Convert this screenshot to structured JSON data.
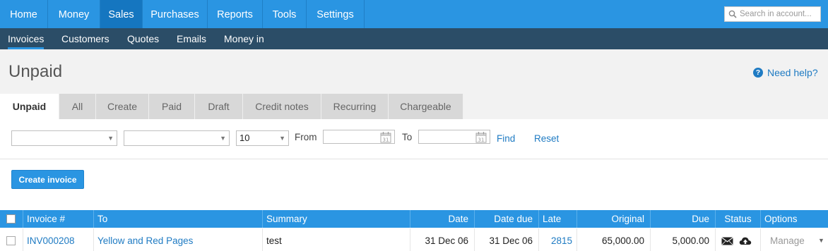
{
  "topnav": {
    "items": [
      "Home",
      "Money",
      "Sales",
      "Purchases",
      "Reports",
      "Tools",
      "Settings"
    ],
    "active": "Sales"
  },
  "search": {
    "placeholder": "Search in account..."
  },
  "subnav": {
    "items": [
      "Invoices",
      "Customers",
      "Quotes",
      "Emails",
      "Money in"
    ],
    "active": "Invoices"
  },
  "page": {
    "title": "Unpaid",
    "help": "Need help?"
  },
  "tabs": [
    "Unpaid",
    "All",
    "Create",
    "Paid",
    "Draft",
    "Credit notes",
    "Recurring",
    "Chargeable"
  ],
  "filters": {
    "select1": "",
    "select2": "",
    "per_page": "10",
    "from_label": "From",
    "to_label": "To",
    "find": "Find",
    "reset": "Reset"
  },
  "actions": {
    "create_invoice": "Create invoice"
  },
  "table": {
    "headers": [
      "Invoice #",
      "To",
      "Summary",
      "Date",
      "Date due",
      "Late",
      "Original",
      "Due",
      "Status",
      "Options"
    ],
    "rows": [
      {
        "invoice": "INV000208",
        "to": "Yellow and Red Pages",
        "summary": "test",
        "date": "31 Dec 06",
        "date_due": "31 Dec 06",
        "late": "2815",
        "original": "65,000.00",
        "due": "5,000.00",
        "status_icons": [
          "envelope-icon",
          "cloud-upload-icon"
        ],
        "manage": "Manage"
      }
    ]
  },
  "colors": {
    "accent": "#2a95e2",
    "subnav": "#2b4d67",
    "link": "#1f7bc3"
  }
}
